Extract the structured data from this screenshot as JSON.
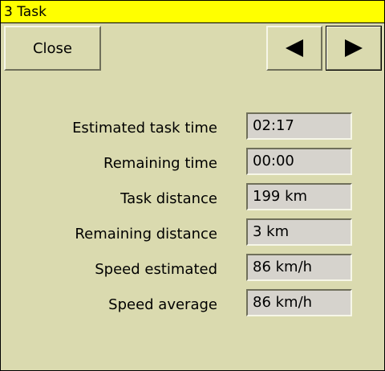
{
  "window": {
    "title": "3 Task"
  },
  "toolbar": {
    "close_label": "Close",
    "prev_icon": "triangle-left",
    "next_icon": "triangle-right"
  },
  "task": {
    "rows": [
      {
        "label": "Estimated task time",
        "value": "02:17"
      },
      {
        "label": "Remaining time",
        "value": "00:00"
      },
      {
        "label": "Task distance",
        "value": "199 km"
      },
      {
        "label": "Remaining distance",
        "value": "3 km"
      },
      {
        "label": "Speed estimated",
        "value": "86 km/h"
      },
      {
        "label": "Speed average",
        "value": "86 km/h"
      }
    ]
  },
  "colors": {
    "titlebar": "#ffff00",
    "background": "#dadaaf",
    "field": "#d6d3cd"
  }
}
